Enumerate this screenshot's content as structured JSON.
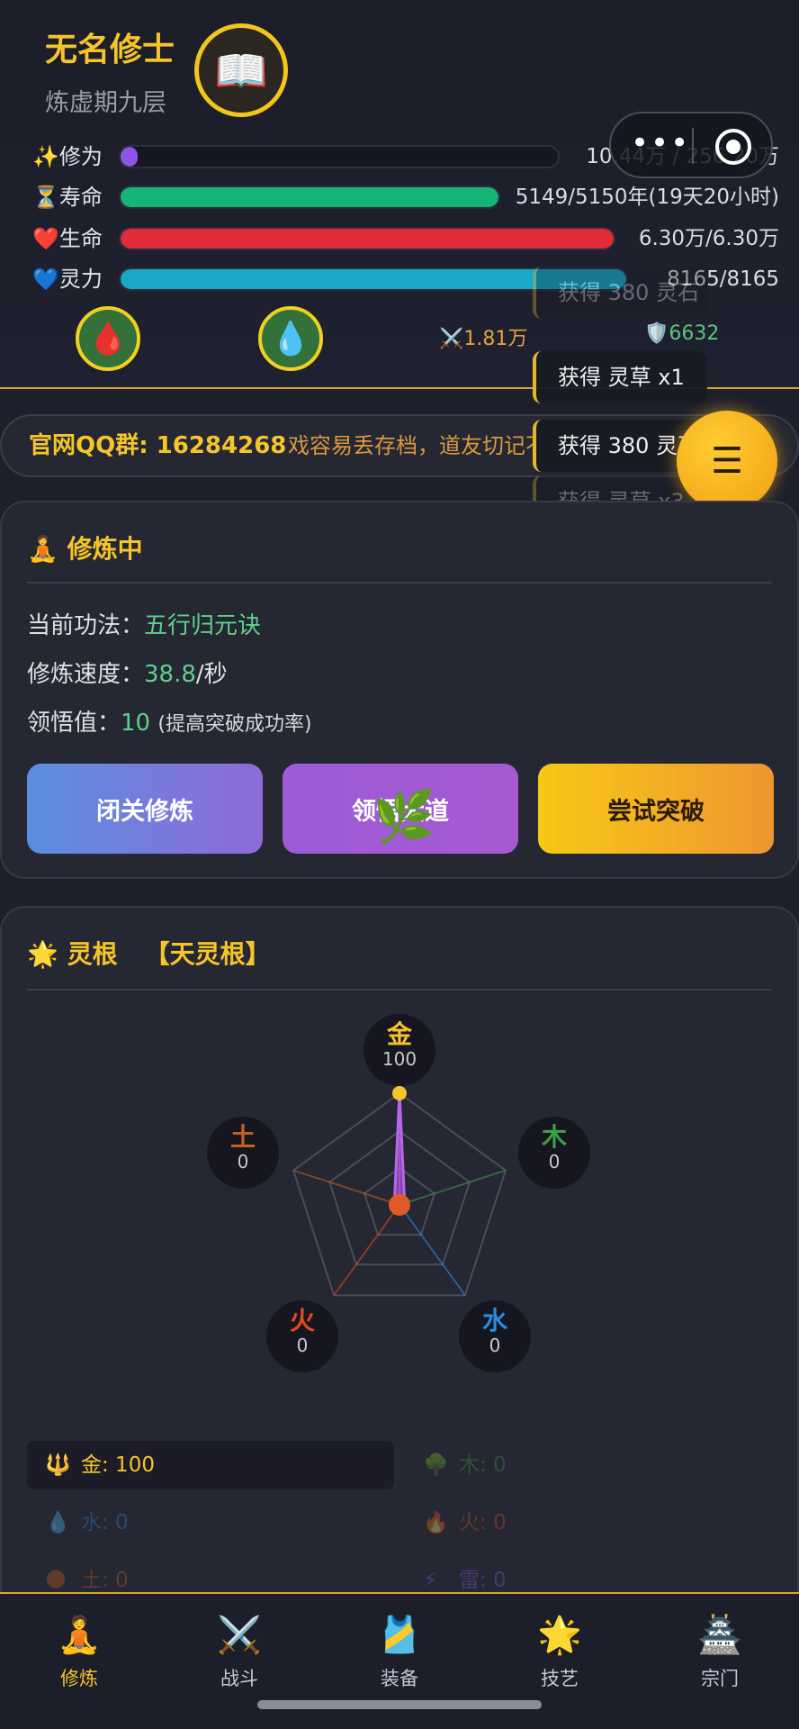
{
  "player": {
    "name": "无名修士",
    "realm": "炼虚期九层",
    "avatar_icon": "book-icon"
  },
  "stats": {
    "cultivation": {
      "label": "✨修为",
      "value": "10.44万 / 256.20万",
      "fraction": 0.04,
      "color": "#8c55e8"
    },
    "lifespan": {
      "label": "⏳寿命",
      "value": "5149/5150年(19天20小时)",
      "fraction": 0.999,
      "color": "#17b573"
    },
    "health": {
      "label": "❤️生命",
      "value": "6.30万/6.30万",
      "fraction": 1.0,
      "color": "#e02b38"
    },
    "mana": {
      "label": "💙灵力",
      "value": "8165/8165",
      "fraction": 1.0,
      "color": "#18a8c8"
    }
  },
  "combat": {
    "attack": "1.81万",
    "defense": "6632",
    "attack_icon": "crossed-swords-icon",
    "defense_icon": "shield-icon",
    "health_potion_icon": "blood-drop-icon",
    "mana_potion_icon": "water-drop-icon"
  },
  "toasts": [
    {
      "text": "获得 380 灵石",
      "faded": true
    },
    {
      "text": "获得 灵草 x1",
      "faded": false
    },
    {
      "text": "获得 380 灵石",
      "faded": false
    },
    {
      "text": "获得 灵草 x3",
      "faded": true
    }
  ],
  "marquee": {
    "group": "官网QQ群: 16284268",
    "tip": "戏容易丢存档，道友切记不"
  },
  "cultivating": {
    "title": "修炼中",
    "method_label": "当前功法：",
    "method_value": "五行归元诀",
    "speed_label": "修炼速度：",
    "speed_value": "38.8",
    "speed_unit": "/秒",
    "insight_label": "领悟值：",
    "insight_value": "10",
    "insight_note": "(提高突破成功率)",
    "buttons": [
      "闭关修炼",
      "领悟大道",
      "尝试突破"
    ]
  },
  "spirit_root": {
    "title": "灵根",
    "type": "【天灵根】",
    "elements": [
      {
        "name": "金",
        "value": 100,
        "color": "#f5c52a"
      },
      {
        "name": "木",
        "value": 0,
        "color": "#3aa04a"
      },
      {
        "name": "水",
        "value": 0,
        "color": "#2a8ce0"
      },
      {
        "name": "火",
        "value": 0,
        "color": "#e04a20"
      },
      {
        "name": "土",
        "value": 0,
        "color": "#c8601a"
      }
    ],
    "attributes": [
      {
        "icon": "🔱",
        "text": "金: 100",
        "color": "#f5c52a",
        "dim": false
      },
      {
        "icon": "🌳",
        "text": "木: 0",
        "color": "#3aa04a",
        "dim": true
      },
      {
        "icon": "💧",
        "text": "水: 0",
        "color": "#2a8ce0",
        "dim": true
      },
      {
        "icon": "🔥",
        "text": "火: 0",
        "color": "#e04a20",
        "dim": true
      },
      {
        "icon": "🌑",
        "text": "土: 0",
        "color": "#c8601a",
        "dim": true
      },
      {
        "icon": "⚡",
        "text": "雷: 0",
        "color": "#8a55e8",
        "dim": true
      }
    ]
  },
  "nav": [
    {
      "label": "修炼",
      "icon": "🧘",
      "active": true
    },
    {
      "label": "战斗",
      "icon": "⚔️",
      "active": false
    },
    {
      "label": "装备",
      "icon": "🎽",
      "active": false
    },
    {
      "label": "技艺",
      "icon": "🌟",
      "active": false
    },
    {
      "label": "宗门",
      "icon": "🏯",
      "active": false
    }
  ],
  "colors": {
    "accent": "#f5c52a",
    "panel": "#252733",
    "background": "#1d1f2b"
  }
}
